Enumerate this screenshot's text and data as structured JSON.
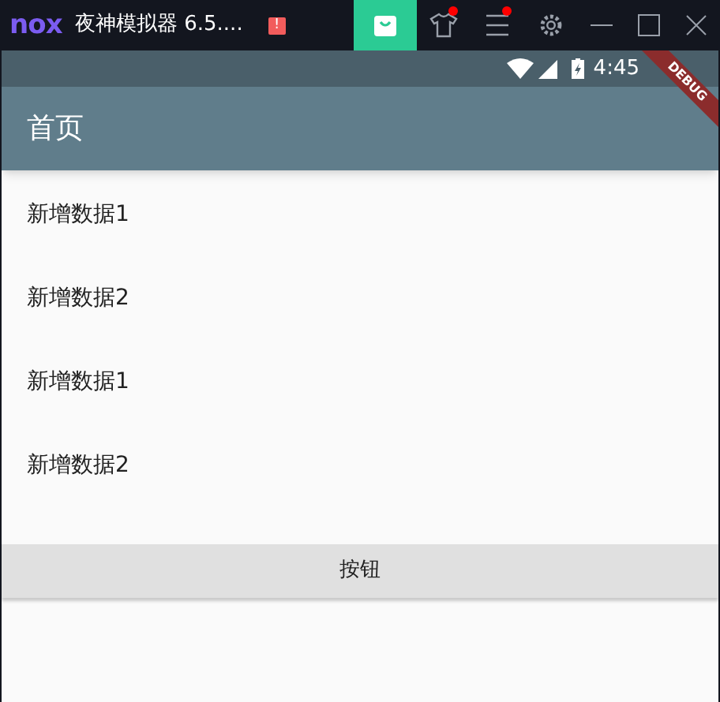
{
  "emulator_bar": {
    "logo": "nox",
    "title": "夜神模拟器 6.5....",
    "alert": "!",
    "tools": [
      {
        "kind": "store",
        "notification": false
      },
      {
        "kind": "skin",
        "notification": true
      },
      {
        "kind": "menu",
        "notification": true
      },
      {
        "kind": "settings",
        "notification": false
      }
    ]
  },
  "status_bar": {
    "time": "4:45"
  },
  "debug_banner": "DEBUG",
  "app_bar": {
    "title": "首页"
  },
  "list": [
    {
      "label": "新增数据1"
    },
    {
      "label": "新增数据2"
    },
    {
      "label": "新增数据1"
    },
    {
      "label": "新增数据2"
    }
  ],
  "button": {
    "label": "按钮"
  }
}
